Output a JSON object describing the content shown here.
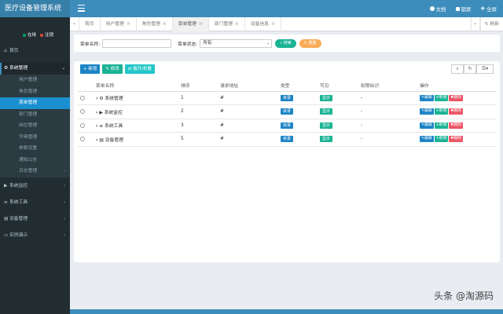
{
  "app": {
    "title": "医疗设备管理系统"
  },
  "top_actions": {
    "doc": "文档",
    "lock": "锁屏",
    "fullscreen": "全屏"
  },
  "user_status": {
    "online": "在线",
    "logout": "注销"
  },
  "sidebar": {
    "home": "首页",
    "system_mgmt": "系统管理",
    "sub_items": [
      "用户管理",
      "角色管理",
      "菜单管理",
      "部门管理",
      "岗位管理",
      "字典管理",
      "参数设置",
      "通知公告",
      "日志管理"
    ],
    "active_sub_index": 2,
    "system_monitor": "系统监控",
    "system_tools": "系统工具",
    "device_mgmt": "设备管理",
    "demo": "实例演示"
  },
  "tabs": [
    {
      "label": "首页"
    },
    {
      "label": "用户管理"
    },
    {
      "label": "角色管理"
    },
    {
      "label": "菜单管理"
    },
    {
      "label": "部门管理"
    },
    {
      "label": "设备信息"
    }
  ],
  "tabs_refresh": "刷新",
  "search": {
    "name_label": "菜单名称:",
    "status_label": "菜单状态:",
    "status_value": "所有",
    "search_btn": "搜索",
    "reset_btn": "重置"
  },
  "toolbar": {
    "add": "新增",
    "edit": "修改",
    "expand": "展开/折叠"
  },
  "table": {
    "headers": [
      "菜单名称",
      "排序",
      "请求地址",
      "类型",
      "可见",
      "权限标识",
      "操作"
    ],
    "rows": [
      {
        "name": "系统管理",
        "icon": "gear-icon",
        "order": "1",
        "url": "#",
        "type": "目录",
        "visible": "显示",
        "perm": "-"
      },
      {
        "name": "系统监控",
        "icon": "video-icon",
        "order": "2",
        "url": "#",
        "type": "目录",
        "visible": "显示",
        "perm": "-"
      },
      {
        "name": "系统工具",
        "icon": "bars-icon",
        "order": "3",
        "url": "#",
        "type": "目录",
        "visible": "显示",
        "perm": "-"
      },
      {
        "name": "设备管理",
        "icon": "device-icon",
        "order": "5",
        "url": "#",
        "type": "目录",
        "visible": "显示",
        "perm": "-"
      }
    ],
    "ops": {
      "edit": "编辑",
      "add": "新增",
      "delete": "删除"
    }
  },
  "watermark": "头条 @淘源码",
  "colors": {
    "brand": "#3c8dbc",
    "sidebar": "#222d32",
    "active": "#1a8fd0",
    "green": "#1ab394",
    "red": "#ed5565",
    "orange": "#f8ac59"
  }
}
